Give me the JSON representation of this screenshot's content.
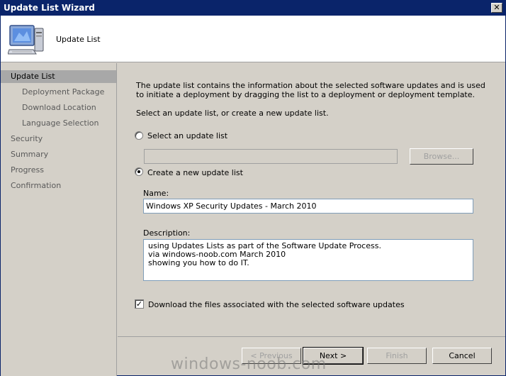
{
  "window": {
    "title": "Update List Wizard",
    "close_glyph": "✕"
  },
  "header": {
    "title": "Update List",
    "icon": "computer-icon"
  },
  "sidebar": {
    "items": [
      {
        "label": "Update List",
        "active": true,
        "sub": false
      },
      {
        "label": "Deployment Package",
        "active": false,
        "sub": true
      },
      {
        "label": "Download Location",
        "active": false,
        "sub": true
      },
      {
        "label": "Language Selection",
        "active": false,
        "sub": true
      },
      {
        "label": "Security",
        "active": false,
        "sub": false
      },
      {
        "label": "Summary",
        "active": false,
        "sub": false
      },
      {
        "label": "Progress",
        "active": false,
        "sub": false
      },
      {
        "label": "Confirmation",
        "active": false,
        "sub": false
      }
    ]
  },
  "main": {
    "description": "The update list contains the information about the selected software updates and is used to initiate a deployment by dragging the list to a deployment or deployment template.",
    "instruction": "Select an update list, or create a new update list.",
    "option_select_label": "Select an update list",
    "option_select_checked": false,
    "select_field_value": "",
    "browse_label": "Browse...",
    "option_create_label": "Create a new update list",
    "option_create_checked": true,
    "name_label": "Name:",
    "name_value": "Windows XP Security Updates - March 2010",
    "description_label": "Description:",
    "description_value": "using Updates Lists as part of the Software Update Process.\nvia windows-noob.com March 2010\nshowing you how to do IT.",
    "download_checkbox_label": "Download the files associated with the selected software updates",
    "download_checked": true,
    "check_glyph": "✓"
  },
  "footer": {
    "previous_label": "< Previous",
    "next_label": "Next >",
    "finish_label": "Finish",
    "cancel_label": "Cancel"
  },
  "watermark": "windows-noob.com"
}
